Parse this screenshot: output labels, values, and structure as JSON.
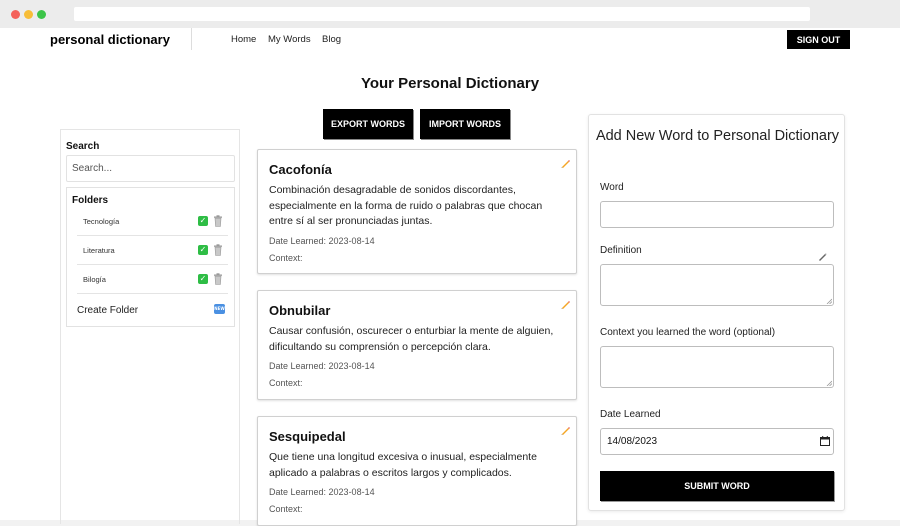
{
  "brand": "personal dictionary",
  "nav": {
    "home": "Home",
    "my_words": "My Words",
    "blog": "Blog",
    "sign_out": "SIGN OUT"
  },
  "page_title": "Your Personal Dictionary",
  "actions": {
    "export": "EXPORT WORDS",
    "import": "IMPORT WORDS"
  },
  "sidebar": {
    "search_label": "Search",
    "search_placeholder": "Search...",
    "folders_label": "Folders",
    "folders": [
      {
        "name": "Tecnología"
      },
      {
        "name": "Literatura"
      },
      {
        "name": "Bilogía"
      }
    ],
    "create_folder": "Create Folder",
    "new_badge": "NEW"
  },
  "words": [
    {
      "word": "Cacofonía",
      "definition": "Combinación desagradable de sonidos discordantes, especialmente en la forma de ruido o palabras que chocan entre sí al ser pronunciadas juntas.",
      "date_learned": "Date Learned: 2023-08-14",
      "context": "Context:"
    },
    {
      "word": "Obnubilar",
      "definition": "Causar confusión, oscurecer o enturbiar la mente de alguien, dificultando su comprensión o percepción clara.",
      "date_learned": "Date Learned: 2023-08-14",
      "context": "Context:"
    },
    {
      "word": "Sesquipedal",
      "definition": "Que tiene una longitud excesiva o inusual, especialmente aplicado a palabras o escritos largos y complicados.",
      "date_learned": "Date Learned: 2023-08-14",
      "context": "Context:"
    }
  ],
  "form": {
    "title": "Add New Word to Personal Dictionary",
    "word_label": "Word",
    "word_value": "",
    "definition_label": "Definition",
    "definition_value": "",
    "context_label": "Context you learned the word (optional)",
    "context_value": "",
    "date_label": "Date Learned",
    "date_value": "14/08/2023",
    "submit": "SUBMIT WORD"
  },
  "colors": {
    "accent": "#000000",
    "check": "#2ebd45",
    "new_badge": "#4a90e2"
  }
}
